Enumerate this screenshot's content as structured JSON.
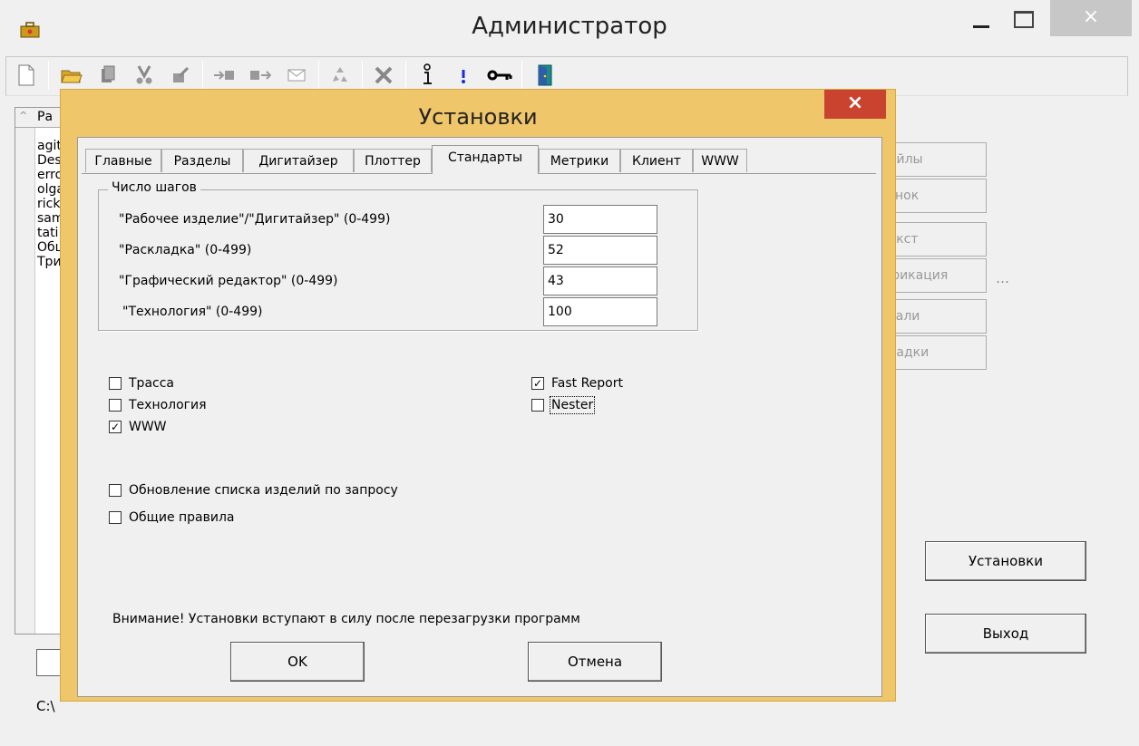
{
  "window": {
    "title": "Администратор",
    "close_glyph": "×"
  },
  "toolbar": {
    "icons": [
      "new-file-icon",
      "open-folder-icon",
      "copy-icon",
      "cut-icon",
      "edit-icon",
      "import-icon",
      "export-icon",
      "mail-icon",
      "recycle-icon",
      "delete-icon",
      "info-icon",
      "alert-icon",
      "key-icon",
      "exit-door-icon"
    ]
  },
  "background": {
    "list_header": "Ра",
    "list_items": [
      "agit",
      "Des",
      "erro",
      "olga",
      "rick",
      "sam",
      "tati",
      "Обц",
      "Три"
    ],
    "path": "C:\\",
    "side_buttons": [
      "райлы",
      "сунок",
      "Текст",
      "ификация",
      "етали",
      "кладки"
    ],
    "ellipsis": "…",
    "settings_button": "Установки",
    "exit_button": "Выход"
  },
  "dialog": {
    "title": "Установки",
    "close_glyph": "×",
    "tabs": [
      "Главные",
      "Разделы",
      "Дигитайзер",
      "Плоттер",
      "Стандарты",
      "Метрики",
      "Клиент",
      "WWW"
    ],
    "active_tab": "Стандарты",
    "steps_group": {
      "legend": "Число шагов",
      "rows": [
        {
          "label": "\"Рабочее изделие\"/\"Дигитайзер\" (0-499)",
          "value": "30"
        },
        {
          "label": "\"Раскладка\" (0-499)",
          "value": "52"
        },
        {
          "label": "\"Графический редактор\" (0-499)",
          "value": "43"
        },
        {
          "label": "\"Технология\" (0-499)",
          "value": "100"
        }
      ]
    },
    "checkboxes": {
      "trassa": {
        "label": "Трасса",
        "checked": false
      },
      "technology": {
        "label": "Технология",
        "checked": false
      },
      "www": {
        "label": "WWW",
        "checked": true
      },
      "fast_report": {
        "label": "Fast Report",
        "checked": true
      },
      "nester": {
        "label": "Nester",
        "checked": false
      },
      "update_on_request": {
        "label": "Обновление списка изделий по запросу",
        "checked": false
      },
      "common_rules": {
        "label": "Общие правила",
        "checked": false
      }
    },
    "check_glyph": "✓",
    "warning": "Внимание!  Установки вступают в силу после перезагрузки программ",
    "ok_button": "OK",
    "cancel_button": "Отмена"
  }
}
